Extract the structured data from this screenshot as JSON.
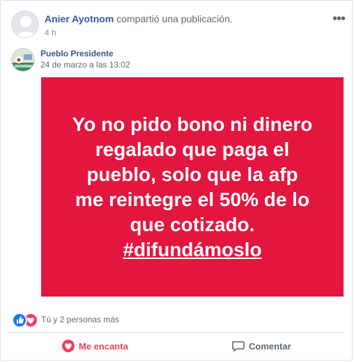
{
  "post": {
    "author": "Anier Ayotnom",
    "action_text": "compartió una publicación.",
    "time": "4 h",
    "more_icon": "ellipsis-icon"
  },
  "shared": {
    "page_name": "Pueblo Presidente",
    "date": "24 de marzo a las 13:02",
    "text_lines": [
      "Yo no pido bono ni dinero",
      "regalado que paga el",
      "pueblo, solo que la afp",
      "me reintegre el 50% de lo",
      "que cotizado."
    ],
    "hashtag": "#difundámoslo",
    "background_color": "#e3163f"
  },
  "reactions": {
    "summary": "Tú y 2 personas más",
    "icons": [
      "like-reaction-icon",
      "love-reaction-icon"
    ]
  },
  "actions": {
    "love_label": "Me encanta",
    "comment_label": "Comentar"
  },
  "colors": {
    "link": "#385898",
    "love": "#f33e58",
    "like": "#1877f2"
  }
}
